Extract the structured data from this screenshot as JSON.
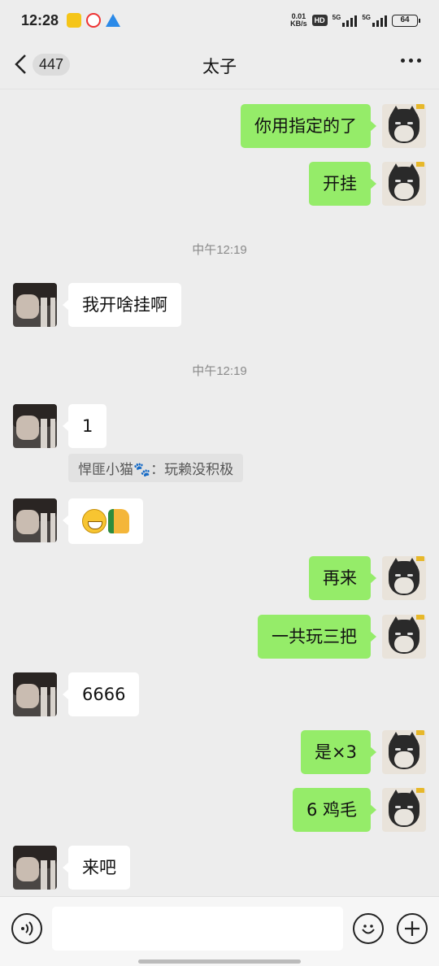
{
  "status_bar": {
    "time": "12:28",
    "icons": [
      "meituan-icon",
      "app-icon",
      "paper-plane-icon"
    ],
    "net_speed_value": "0.01",
    "net_speed_unit": "KB/s",
    "hd": "HD",
    "sig1_label": "5G",
    "sig2_label": "5G",
    "battery": "64"
  },
  "nav": {
    "back_badge": "447",
    "title": "太子"
  },
  "messages": [
    {
      "side": "right",
      "text": "你用指定的了"
    },
    {
      "side": "right",
      "text": "开挂"
    },
    {
      "type": "time",
      "text": "中午12:19"
    },
    {
      "side": "left",
      "text": "我开啥挂啊"
    },
    {
      "type": "time",
      "text": "中午12:19"
    },
    {
      "side": "left",
      "text": "1"
    },
    {
      "type": "quote",
      "text": "悍匪小猫🐾：玩赖没积极"
    },
    {
      "side": "left",
      "emoji": [
        "grinning-face",
        "thumbs-up"
      ]
    },
    {
      "side": "right",
      "text": "再来"
    },
    {
      "side": "right",
      "text": "一共玩三把"
    },
    {
      "side": "left",
      "text": "6666"
    },
    {
      "side": "right",
      "text": "是×3"
    },
    {
      "side": "right",
      "text": "6 鸡毛"
    },
    {
      "side": "left",
      "text": "来吧"
    }
  ],
  "input_bar": {
    "left_icon": "voice-icon",
    "right_icons": [
      "emoji-icon",
      "plus-icon"
    ],
    "text_value": ""
  },
  "colors": {
    "sent_bubble": "#95ec69",
    "received_bubble": "#ffffff",
    "background": "#ededed"
  }
}
